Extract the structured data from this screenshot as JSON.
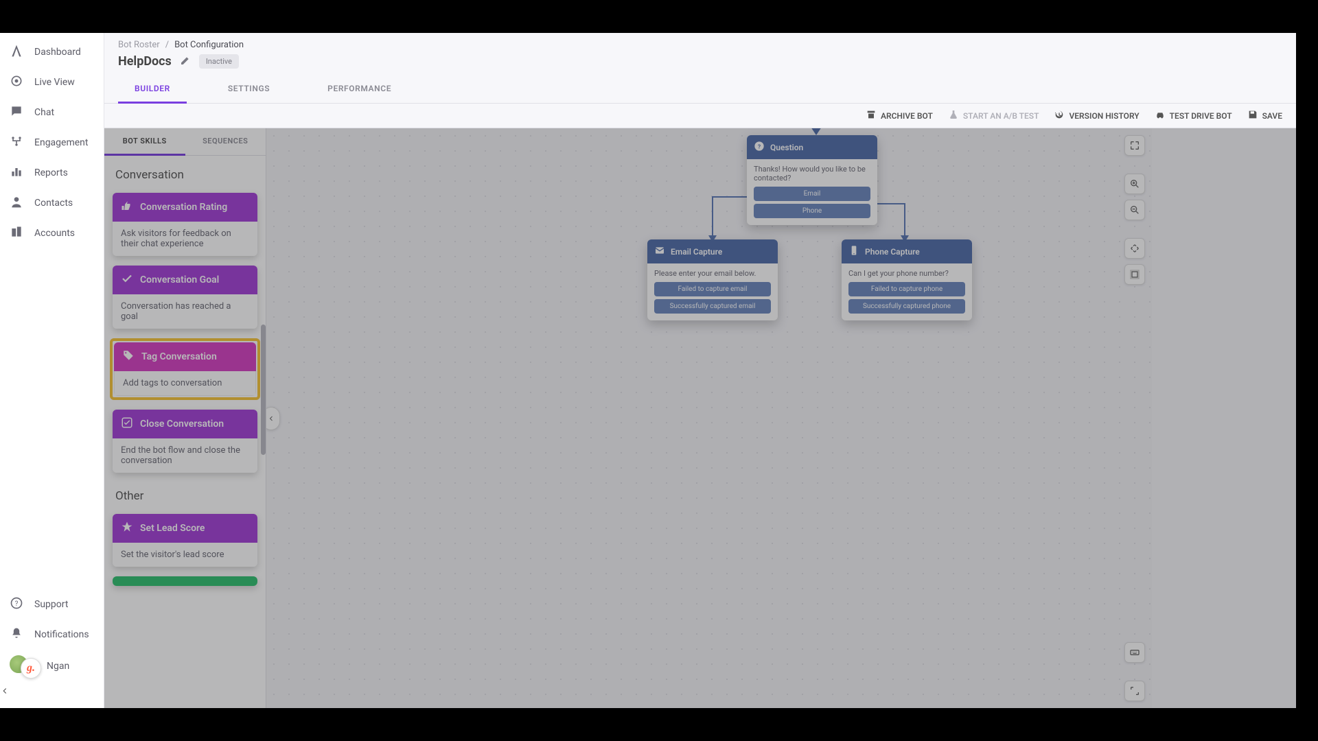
{
  "sidebar": {
    "items": [
      {
        "label": "Dashboard"
      },
      {
        "label": "Live View"
      },
      {
        "label": "Chat"
      },
      {
        "label": "Engagement"
      },
      {
        "label": "Reports"
      },
      {
        "label": "Contacts"
      },
      {
        "label": "Accounts"
      }
    ],
    "bottom": [
      {
        "label": "Support"
      },
      {
        "label": "Notifications"
      }
    ],
    "user_name": "Ngan",
    "avatar_initial": "g."
  },
  "breadcrumb": {
    "a": "Bot Roster",
    "b": "Bot Configuration"
  },
  "bot": {
    "name": "HelpDocs",
    "status": "Inactive"
  },
  "tabs": {
    "builder": "BUILDER",
    "settings": "SETTINGS",
    "performance": "PERFORMANCE"
  },
  "actions": {
    "archive": "ARCHIVE BOT",
    "abtest": "START AN A/B TEST",
    "history": "VERSION HISTORY",
    "testdrive": "TEST DRIVE BOT",
    "save": "SAVE"
  },
  "skills_tabs": {
    "skills": "BOT SKILLS",
    "sequences": "SEQUENCES"
  },
  "sections": {
    "conversation": "Conversation",
    "other": "Other"
  },
  "skills": {
    "rating": {
      "title": "Conversation Rating",
      "desc": "Ask visitors for feedback on their chat experience"
    },
    "goal": {
      "title": "Conversation Goal",
      "desc": "Conversation has reached a goal"
    },
    "tag": {
      "title": "Tag Conversation",
      "desc": "Add tags to conversation"
    },
    "close": {
      "title": "Close Conversation",
      "desc": "End the bot flow and close the conversation"
    },
    "leadscore": {
      "title": "Set Lead Score",
      "desc": "Set the visitor's lead score"
    }
  },
  "flow": {
    "question": {
      "title": "Question",
      "msg": "Thanks! How would you like to be contacted?",
      "opt1": "Email",
      "opt2": "Phone"
    },
    "email": {
      "title": "Email Capture",
      "msg": "Please enter your email below.",
      "fail": "Failed to capture email",
      "ok": "Successfully captured email"
    },
    "phone": {
      "title": "Phone Capture",
      "msg": "Can I get your phone number?",
      "fail": "Failed to capture phone",
      "ok": "Successfully captured phone"
    }
  }
}
